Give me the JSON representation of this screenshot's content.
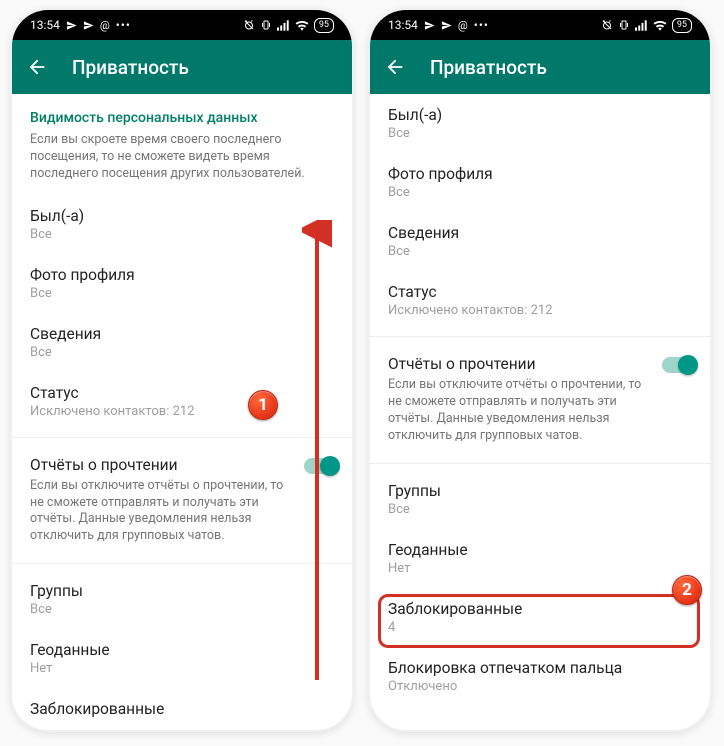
{
  "statusbar": {
    "time": "13:54",
    "battery": "95"
  },
  "appbar": {
    "title": "Приватность"
  },
  "left": {
    "section_header": "Видимость персональных данных",
    "section_desc": "Если вы скроете время своего последнего посещения, то не сможете видеть время последнего посещения других пользователей.",
    "last_seen": {
      "title": "Был(-а)",
      "sub": "Все"
    },
    "photo": {
      "title": "Фото профиля",
      "sub": "Все"
    },
    "about": {
      "title": "Сведения",
      "sub": "Все"
    },
    "status": {
      "title": "Статус",
      "sub": "Исключено контактов: 212"
    },
    "read": {
      "title": "Отчёты о прочтении",
      "desc": "Если вы отключите отчёты о прочтении, то не сможете отправлять и получать эти отчёты. Данные уведомления нельзя отключить для групповых чатов."
    },
    "groups": {
      "title": "Группы",
      "sub": "Все"
    },
    "live": {
      "title": "Геоданные",
      "sub": "Нет"
    },
    "blocked": {
      "title": "Заблокированные"
    }
  },
  "right": {
    "last_seen": {
      "title": "Был(-а)",
      "sub": "Все"
    },
    "photo": {
      "title": "Фото профиля",
      "sub": "Все"
    },
    "about": {
      "title": "Сведения",
      "sub": "Все"
    },
    "status": {
      "title": "Статус",
      "sub": "Исключено контактов: 212"
    },
    "read": {
      "title": "Отчёты о прочтении",
      "desc": "Если вы отключите отчёты о прочтении, то не сможете отправлять и получать эти отчёты. Данные уведомления нельзя отключить для групповых чатов."
    },
    "groups": {
      "title": "Группы",
      "sub": "Все"
    },
    "live": {
      "title": "Геоданные",
      "sub": "Нет"
    },
    "blocked": {
      "title": "Заблокированные",
      "sub": "4"
    },
    "finger": {
      "title": "Блокировка отпечатком пальца",
      "sub": "Отключено"
    }
  },
  "annotations": {
    "badge1": "1",
    "badge2": "2"
  }
}
